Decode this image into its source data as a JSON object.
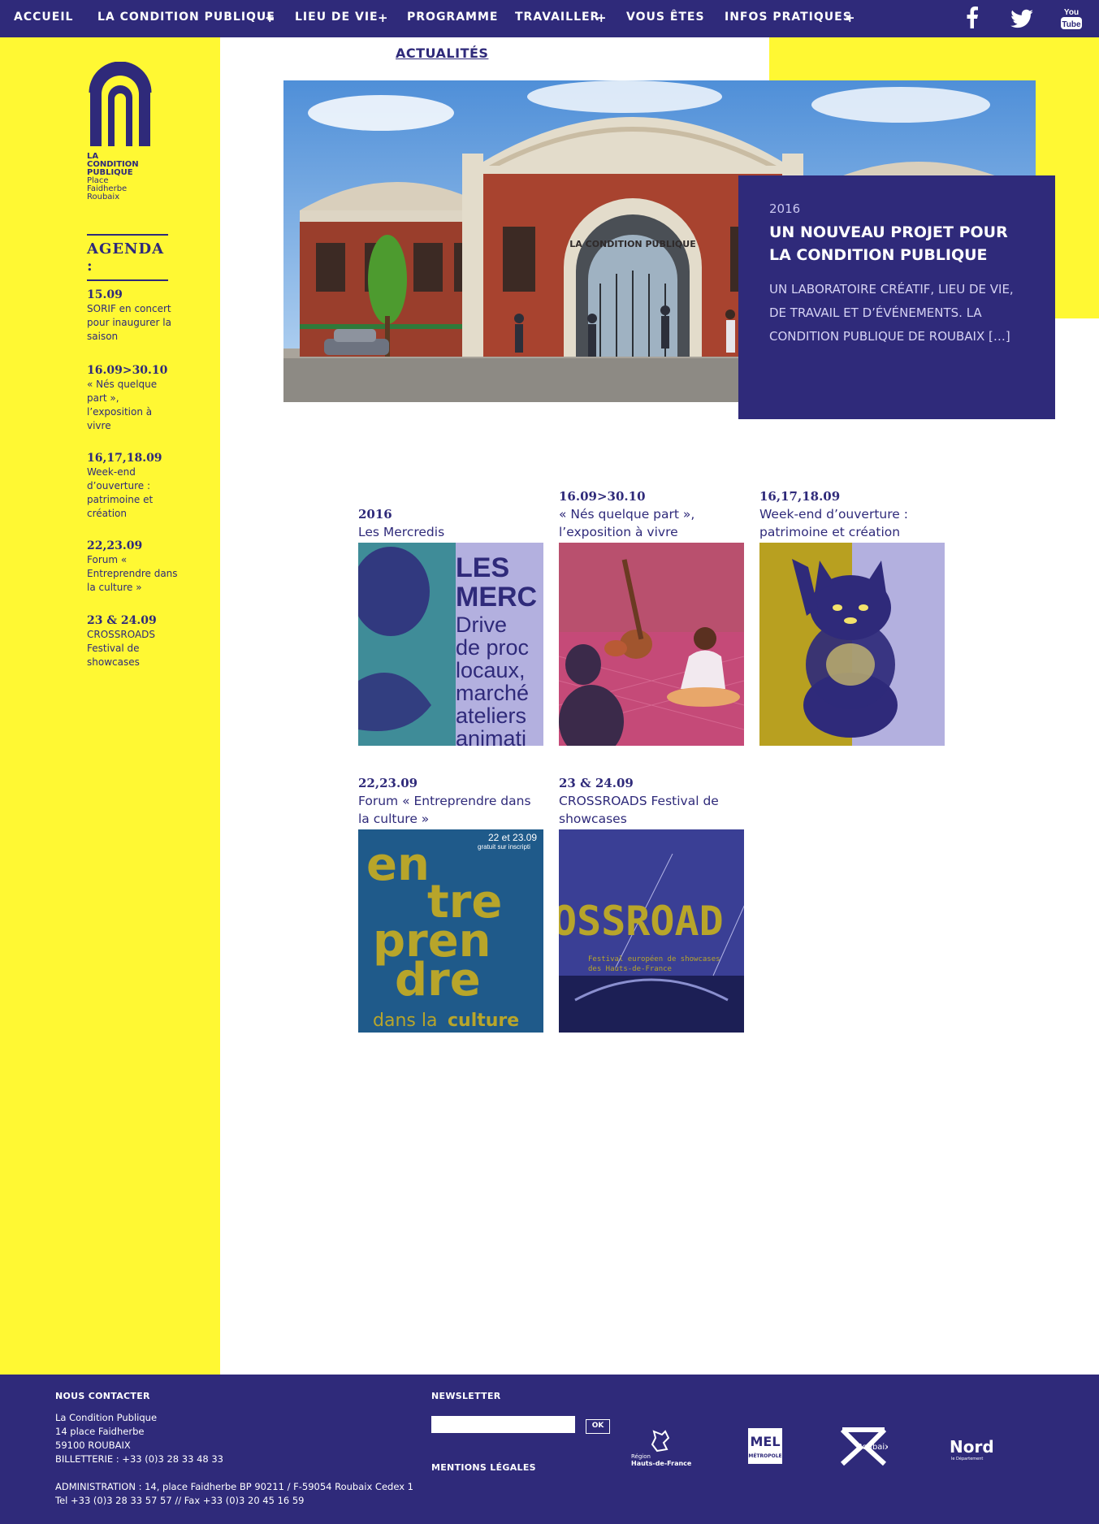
{
  "nav": {
    "items": [
      {
        "label": "ACCUEIL",
        "has_submenu": false
      },
      {
        "label": "LA CONDITION PUBLIQUE",
        "has_submenu": true
      },
      {
        "label": "LIEU DE VIE",
        "has_submenu": true
      },
      {
        "label": "PROGRAMME",
        "has_submenu": false
      },
      {
        "label": "TRAVAILLER",
        "has_submenu": true
      },
      {
        "label": "VOUS ÊTES",
        "has_submenu": false
      },
      {
        "label": "INFOS PRATIQUES",
        "has_submenu": true
      }
    ],
    "plus": "+",
    "social": [
      "facebook-icon",
      "twitter-icon",
      "youtube-icon"
    ],
    "youtube_label_1": "You",
    "youtube_label_2": "Tube"
  },
  "logo": {
    "line1": "LA",
    "line2": "CONDITION",
    "line3": "PUBLIQUE",
    "line4": "Place",
    "line5": "Faidherbe",
    "line6": "Roubaix"
  },
  "agenda": {
    "title": "AGENDA :",
    "items": [
      {
        "date": "15.09",
        "text": "SORIF en concert pour inaugurer la saison"
      },
      {
        "date": "16.09>30.10",
        "text": "« Nés quelque part », l’exposition à vivre"
      },
      {
        "date": "16,17,18.09",
        "text": "Week-end d’ouverture : patrimoine et création"
      },
      {
        "date": "22,23.09",
        "text": "Forum « Entreprendre dans la culture »"
      },
      {
        "date": "23 & 24.09",
        "text": "CROSSROADS Festival de showcases"
      }
    ]
  },
  "main": {
    "section_title": "ACTUALITÉS",
    "hero": {
      "year": "2016",
      "title": "UN NOUVEAU PROJET POUR LA CONDITION PUBLIQUE",
      "description": "UN LABORATOIRE CRÉATIF, LIEU DE VIE, DE TRAVAIL ET D’ÉVÉNEMENTS. LA CONDITION PUBLIQUE DE ROUBAIX […]",
      "building_sign": "LA CONDITION PUBLIQUE"
    },
    "cards": [
      {
        "date": "2016",
        "title": "Les Mercredis",
        "img_lines": [
          "LES",
          "MERC",
          "Drive",
          "de proc",
          "locaux,",
          "marché",
          "ateliers",
          "animati"
        ]
      },
      {
        "date": "16.09>30.10",
        "title": "« Nés quelque part », l’exposition à vivre"
      },
      {
        "date": "16,17,18.09",
        "title": "Week-end d’ouverture : patrimoine et création"
      },
      {
        "date": "22,23.09",
        "title": "Forum « Entreprendre dans la culture »",
        "img_lines": [
          "en",
          "tre",
          "pren",
          "dre"
        ],
        "img_top": "22 et 23.09",
        "img_sub": "gratuit sur inscripti",
        "img_bottom_a": "dans la",
        "img_bottom_b": "culture"
      },
      {
        "date": "23 & 24.09",
        "title": "CROSSROADS Festival de showcases",
        "img_big": "OSSROAD",
        "img_sub1": "Festival européen de showcases",
        "img_sub2": "des Hauts-de-France"
      }
    ]
  },
  "footer": {
    "contact_title": "NOUS CONTACTER",
    "contact_lines": [
      "La Condition Publique",
      "14 place Faidherbe",
      "59100 ROUBAIX",
      "BILLETTERIE : +33 (0)3 28 33 48 33"
    ],
    "admin_lines": [
      "ADMINISTRATION : 14, place Faidherbe BP 90211 / F-59054 Roubaix Cedex 1",
      "Tel +33 (0)3 28 33 57 57 // Fax +33 (0)3 20 45 16 59"
    ],
    "newsletter_title": "NEWSLETTER",
    "newsletter_placeholder": "",
    "ok_label": "OK",
    "legal_title": "MENTIONS LÉGALES",
    "partners": {
      "region_line1": "Région",
      "region_line2": "Hauts-de-France",
      "mel_big": "MEL",
      "mel_small": "MÉTROPOLE",
      "roubaix": "Roubaix",
      "nord": "Nord",
      "nord_small": "le Département"
    }
  },
  "colors": {
    "primary": "#2f2a7a",
    "accent": "#fff833",
    "white": "#ffffff"
  }
}
